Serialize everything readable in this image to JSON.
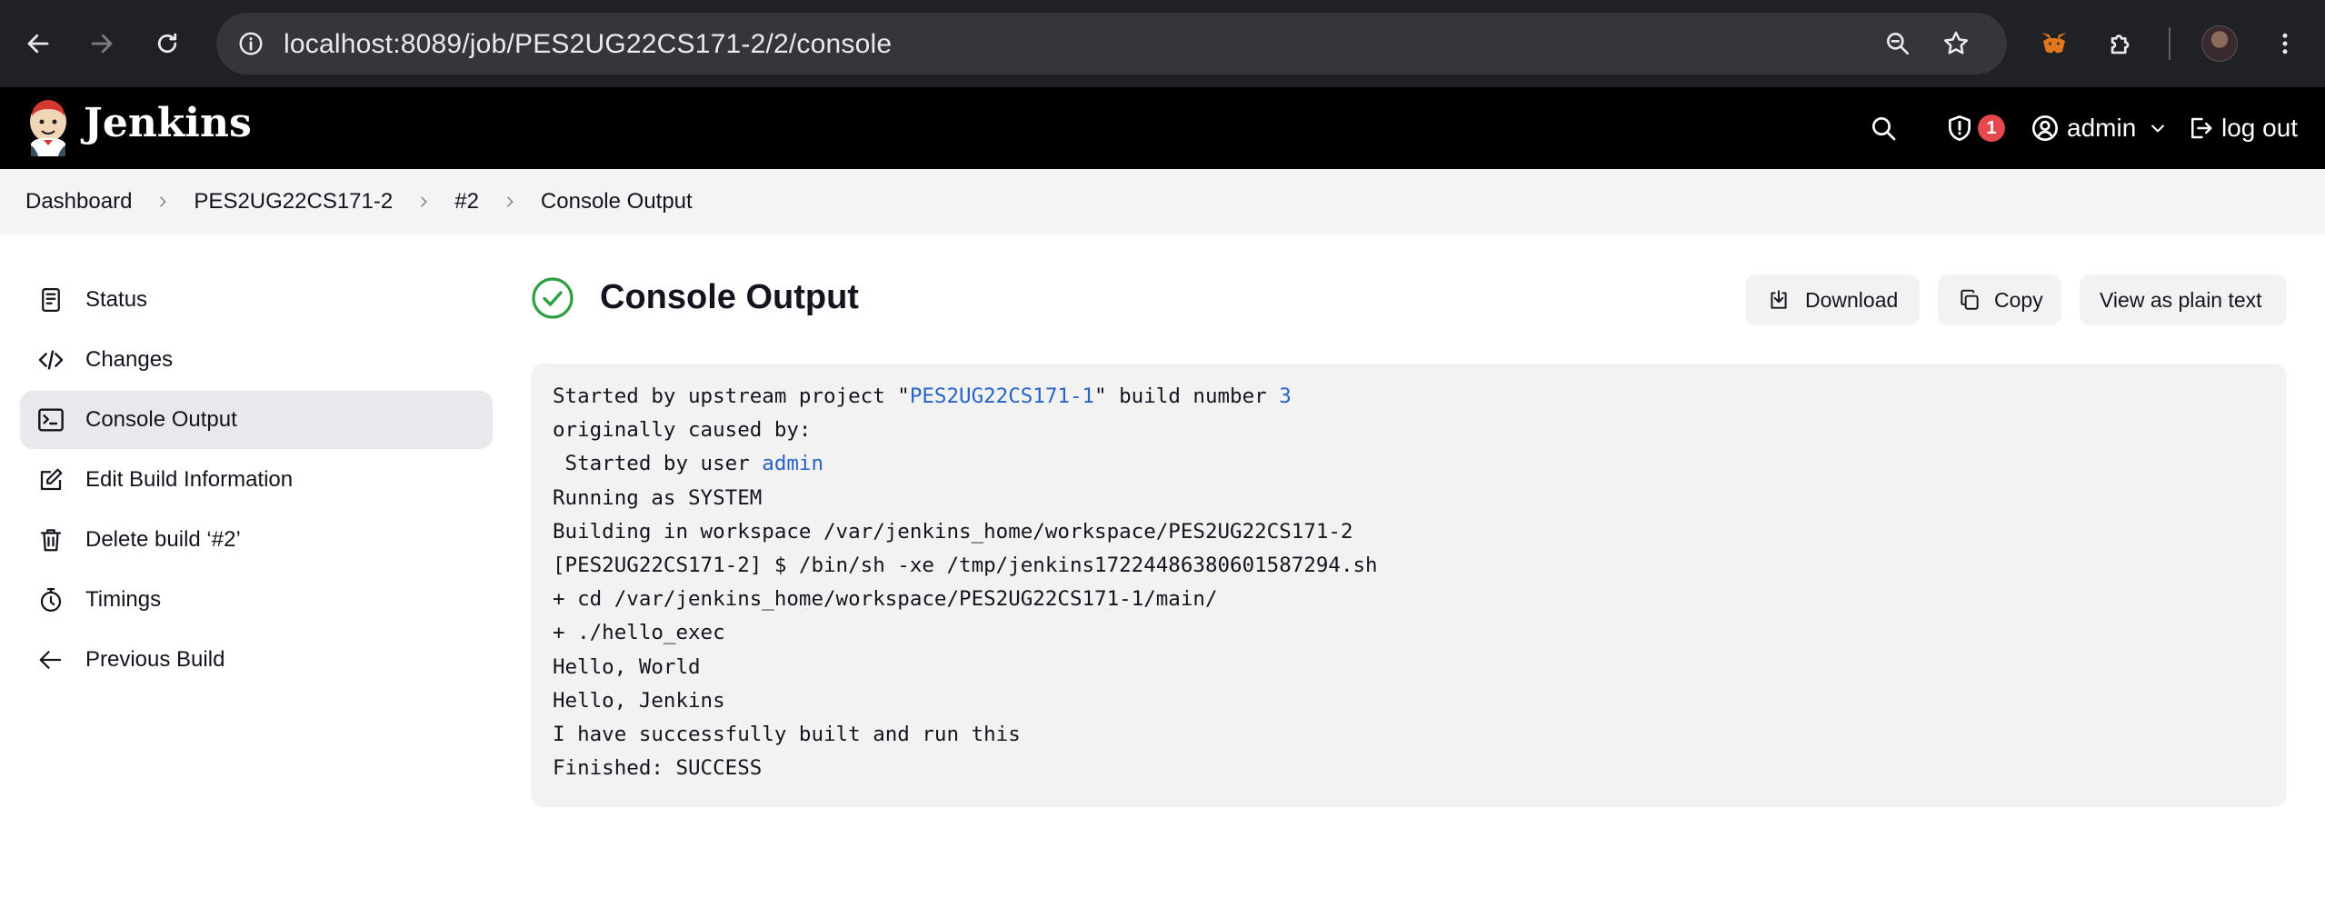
{
  "browser": {
    "url": "localhost:8089/job/PES2UG22CS171-2/2/console"
  },
  "header": {
    "app_name": "Jenkins",
    "security_count": "1",
    "user": "admin",
    "logout": "log out"
  },
  "breadcrumb": [
    "Dashboard",
    "PES2UG22CS171-2",
    "#2",
    "Console Output"
  ],
  "sidebar": {
    "items": [
      {
        "label": "Status",
        "icon": "status-icon"
      },
      {
        "label": "Changes",
        "icon": "code-icon"
      },
      {
        "label": "Console Output",
        "icon": "terminal-icon",
        "active": true
      },
      {
        "label": "Edit Build Information",
        "icon": "edit-icon"
      },
      {
        "label": "Delete build ‘#2’",
        "icon": "trash-icon"
      },
      {
        "label": "Timings",
        "icon": "stopwatch-icon"
      },
      {
        "label": "Previous Build",
        "icon": "arrow-left-icon"
      }
    ]
  },
  "main": {
    "title": "Console Output",
    "buttons": {
      "download": "Download",
      "copy": "Copy",
      "plain": "View as plain text"
    },
    "console": {
      "l1_pre": "Started by upstream project \"",
      "l1_link": "PES2UG22CS171-1",
      "l1_mid": "\" build number ",
      "l1_num": "3",
      "l2": "originally caused by:",
      "l3_pre": " Started by user ",
      "l3_link": "admin",
      "l4": "Running as SYSTEM",
      "l5": "Building in workspace /var/jenkins_home/workspace/PES2UG22CS171-2",
      "l6": "[PES2UG22CS171-2] $ /bin/sh -xe /tmp/jenkins17224486380601587294.sh",
      "l7": "+ cd /var/jenkins_home/workspace/PES2UG22CS171-1/main/",
      "l8": "+ ./hello_exec",
      "l9": "Hello, World",
      "l10": "Hello, Jenkins",
      "l11": "I have successfully built and run this",
      "l12": "Finished: SUCCESS"
    }
  },
  "colors": {
    "success": "#2ea043",
    "link": "#2563c9",
    "badge": "#e5484d"
  }
}
